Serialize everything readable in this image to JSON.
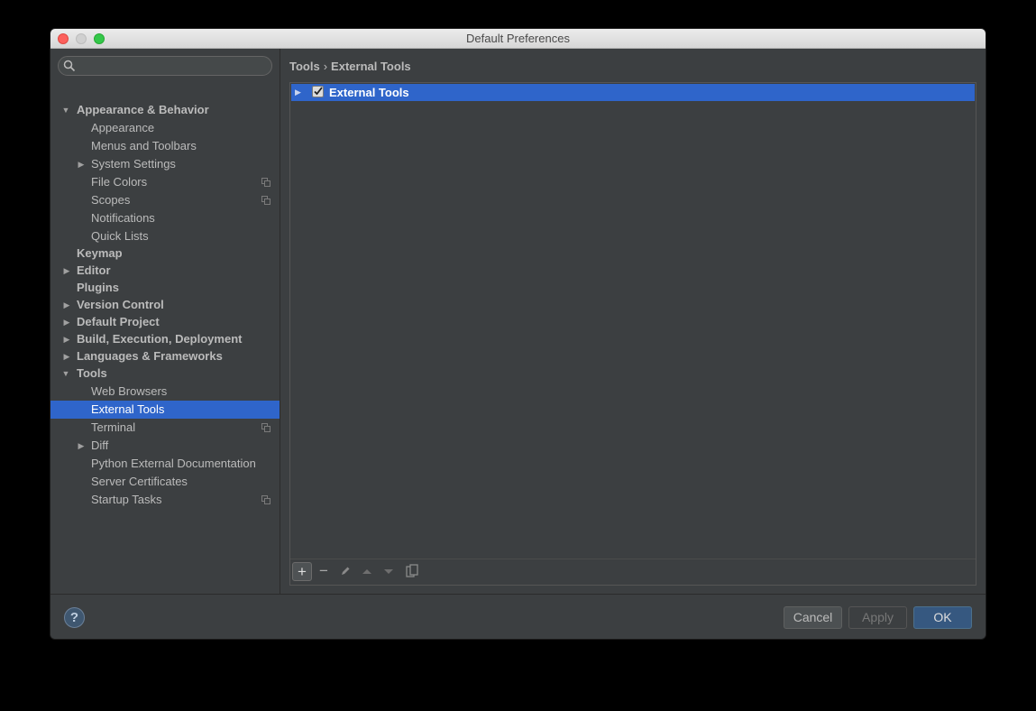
{
  "window": {
    "title": "Default Preferences"
  },
  "search": {
    "value": "",
    "placeholder": ""
  },
  "tree": {
    "items": [
      {
        "label": "Appearance & Behavior",
        "level": 0,
        "expanded": true,
        "bold": true
      },
      {
        "label": "Appearance",
        "level": 1
      },
      {
        "label": "Menus and Toolbars",
        "level": 1
      },
      {
        "label": "System Settings",
        "level": 1,
        "expandable": true
      },
      {
        "label": "File Colors",
        "level": 1,
        "copy": true
      },
      {
        "label": "Scopes",
        "level": 1,
        "copy": true
      },
      {
        "label": "Notifications",
        "level": 1
      },
      {
        "label": "Quick Lists",
        "level": 1
      },
      {
        "label": "Keymap",
        "level": 0,
        "bold": true
      },
      {
        "label": "Editor",
        "level": 0,
        "expandable": true,
        "bold": true
      },
      {
        "label": "Plugins",
        "level": 0,
        "bold": true
      },
      {
        "label": "Version Control",
        "level": 0,
        "expandable": true,
        "bold": true
      },
      {
        "label": "Default Project",
        "level": 0,
        "expandable": true,
        "bold": true
      },
      {
        "label": "Build, Execution, Deployment",
        "level": 0,
        "expandable": true,
        "bold": true
      },
      {
        "label": "Languages & Frameworks",
        "level": 0,
        "expandable": true,
        "bold": true
      },
      {
        "label": "Tools",
        "level": 0,
        "expanded": true,
        "bold": true
      },
      {
        "label": "Web Browsers",
        "level": 1
      },
      {
        "label": "External Tools",
        "level": 1,
        "selected": true
      },
      {
        "label": "Terminal",
        "level": 1,
        "copy": true
      },
      {
        "label": "Diff",
        "level": 1,
        "expandable": true
      },
      {
        "label": "Python External Documentation",
        "level": 1
      },
      {
        "label": "Server Certificates",
        "level": 1
      },
      {
        "label": "Startup Tasks",
        "level": 1,
        "copy": true
      }
    ]
  },
  "breadcrumb": {
    "parent": "Tools",
    "separator": "›",
    "current": "External Tools"
  },
  "panel": {
    "row_label": "External Tools",
    "row_checked": true
  },
  "toolbar": {
    "add": "+",
    "remove": "−",
    "edit_icon": "pencil-icon",
    "up_icon": "arrow-up-icon",
    "down_icon": "arrow-down-icon",
    "copy_icon": "copy-icon"
  },
  "footer": {
    "help": "?",
    "cancel": "Cancel",
    "apply": "Apply",
    "ok": "OK"
  },
  "colors": {
    "selection": "#2f65ca",
    "background": "#3c3f41",
    "text": "#bbbbbb"
  }
}
